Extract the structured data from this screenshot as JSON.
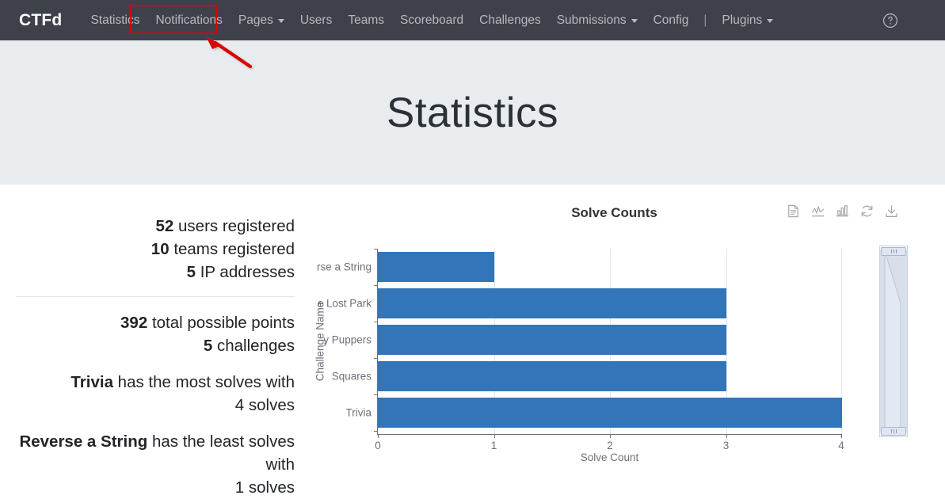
{
  "navbar": {
    "brand": "CTFd",
    "items": [
      {
        "label": "Statistics",
        "caret": false
      },
      {
        "label": "Notifications",
        "caret": false,
        "highlighted": true
      },
      {
        "label": "Pages",
        "caret": true
      },
      {
        "label": "Users",
        "caret": false
      },
      {
        "label": "Teams",
        "caret": false
      },
      {
        "label": "Scoreboard",
        "caret": false
      },
      {
        "label": "Challenges",
        "caret": false
      },
      {
        "label": "Submissions",
        "caret": true
      },
      {
        "label": "Config",
        "caret": false
      },
      {
        "label": "|",
        "divider": true
      },
      {
        "label": "Plugins",
        "caret": true
      }
    ],
    "help_icon": "question-circle-icon",
    "background": "#3e414a",
    "annotation_color": "#d90000"
  },
  "header": {
    "title": "Statistics",
    "background": "#e9ecef"
  },
  "stats": {
    "group1": [
      {
        "value": "52",
        "label": "users registered"
      },
      {
        "value": "10",
        "label": "teams registered"
      },
      {
        "value": "5",
        "label": "IP addresses"
      }
    ],
    "group2": [
      {
        "value": "392",
        "label": "total possible points"
      },
      {
        "value": "5",
        "label": "challenges"
      }
    ],
    "most_solves": {
      "name": "Trivia",
      "text": "has the most solves with",
      "count": "4 solves"
    },
    "least_solves": {
      "name": "Reverse a String",
      "text": "has the least solves with",
      "count": "1 solves"
    }
  },
  "toolbox": {
    "icons": [
      "data-view-icon",
      "line-chart-icon",
      "bar-chart-icon",
      "restore-icon",
      "download-icon"
    ]
  },
  "chart_data": {
    "type": "bar",
    "orientation": "horizontal",
    "title": "Solve Counts",
    "xlabel": "Solve Count",
    "ylabel": "Challenge Name",
    "categories": [
      "Reverse a String",
      "The Lost Park",
      "Baby Puppers",
      "Squares",
      "Trivia"
    ],
    "displayed_labels": [
      "rse a String",
      "e Lost Park",
      "y Puppers",
      "Squares",
      "Trivia"
    ],
    "values": [
      1,
      3,
      3,
      3,
      4
    ],
    "xticks": [
      "0",
      "1",
      "2",
      "3",
      "4"
    ],
    "xlim": [
      0,
      4
    ],
    "grid": true,
    "legend": false,
    "series_color": "#3275b8",
    "datazoom": "vertical-slider"
  }
}
